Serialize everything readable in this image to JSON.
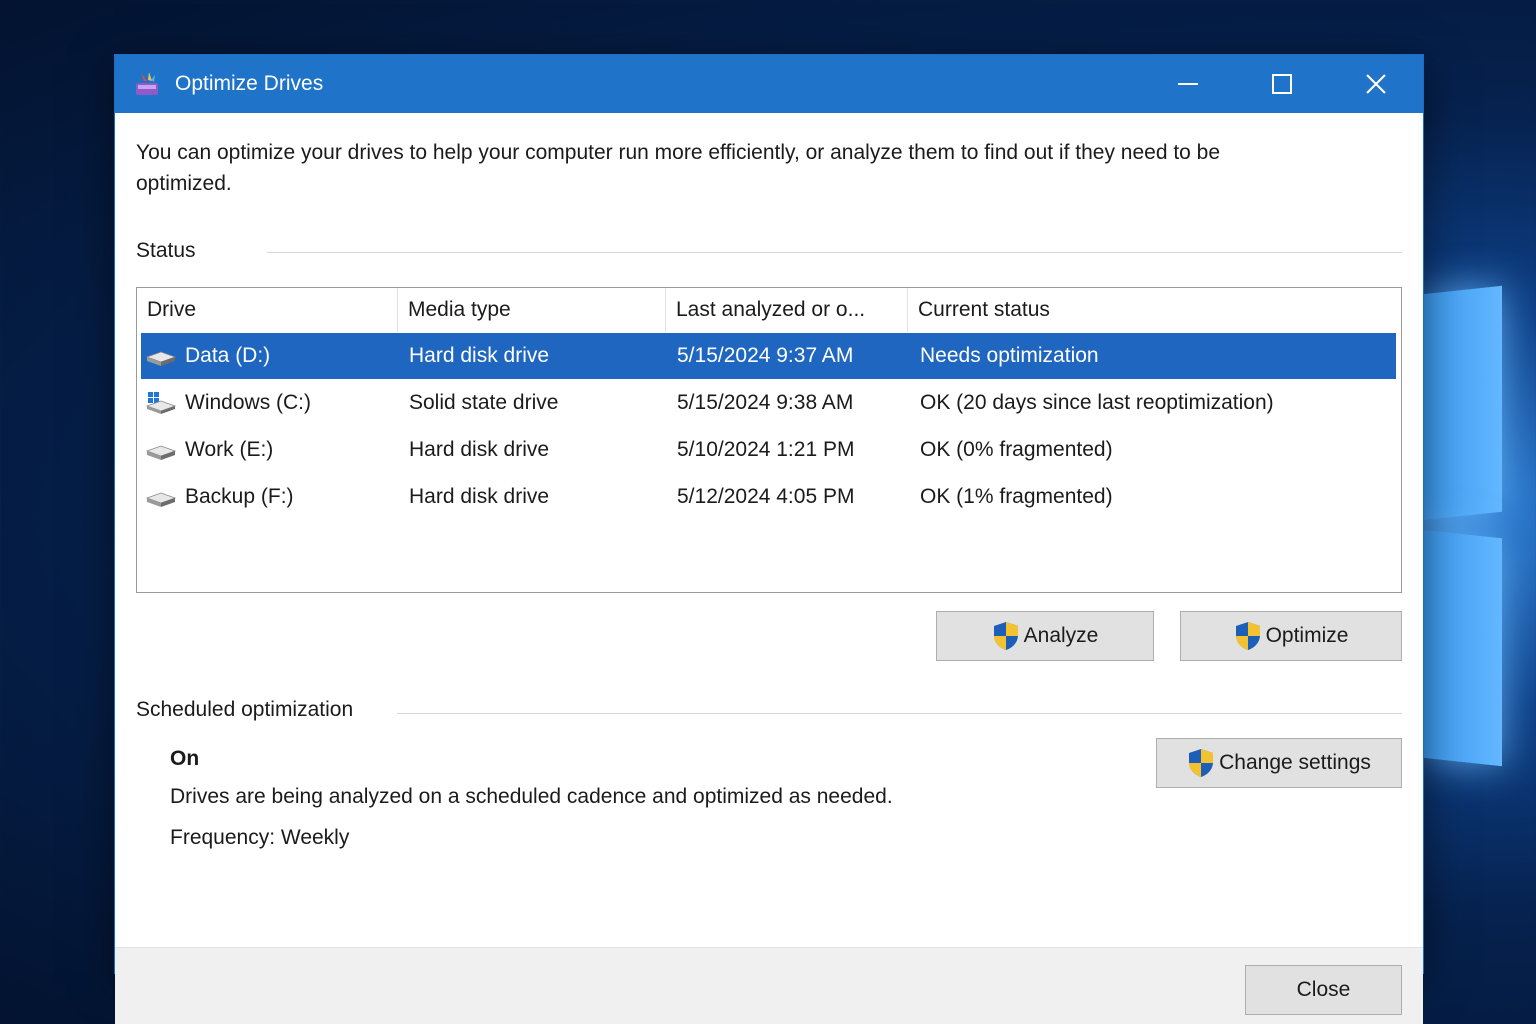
{
  "window": {
    "title": "Optimize Drives",
    "controls": {
      "minimize": "minimize-icon",
      "maximize": "maximize-icon",
      "close": "close-icon"
    }
  },
  "intro_text": "You can optimize your drives to help your computer run more efficiently, or analyze them to find out if they need to be optimized.",
  "status": {
    "label": "Status",
    "columns": [
      "Drive",
      "Media type",
      "Last analyzed or o...",
      "Current status"
    ],
    "rows": [
      {
        "drive": "Data (D:)",
        "icon": "hard-disk-icon",
        "media": "Hard disk drive",
        "last": "5/15/2024 9:37 AM",
        "status": "Needs optimization",
        "selected": true
      },
      {
        "drive": "Windows (C:)",
        "icon": "windows-drive-icon",
        "media": "Solid state drive",
        "last": "5/15/2024 9:38 AM",
        "status": "OK (20 days since last reoptimization)",
        "selected": false
      },
      {
        "drive": "Work (E:)",
        "icon": "hard-disk-icon",
        "media": "Hard disk drive",
        "last": "5/10/2024 1:21 PM",
        "status": "OK (0% fragmented)",
        "selected": false
      },
      {
        "drive": "Backup (F:)",
        "icon": "hard-disk-icon",
        "media": "Hard disk drive",
        "last": "5/12/2024 4:05 PM",
        "status": "OK (1% fragmented)",
        "selected": false
      }
    ],
    "analyze_label": "Analyze",
    "optimize_label": "Optimize"
  },
  "scheduled": {
    "label": "Scheduled optimization",
    "state": "On",
    "description": "Drives are being analyzed on a scheduled cadence and optimized as needed.",
    "frequency": "Frequency: Weekly",
    "change_label": "Change settings"
  },
  "footer": {
    "close_label": "Close"
  },
  "colors": {
    "titlebar": "#1f73c8",
    "selection": "#1f66c1",
    "button_face": "#e1e1e1"
  }
}
